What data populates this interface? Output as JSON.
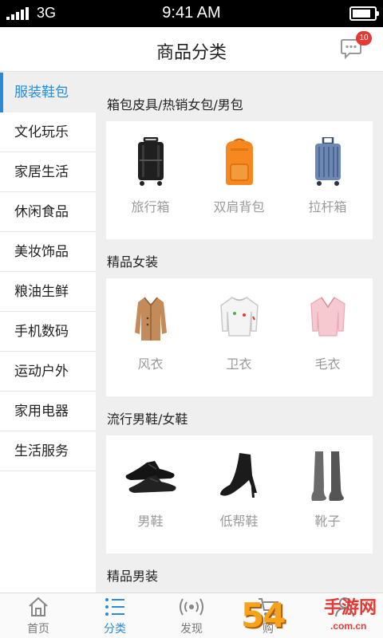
{
  "status_bar": {
    "carrier": "3G",
    "time": "9:41 AM",
    "signal_bars": 5,
    "battery_level": 0.85
  },
  "header": {
    "title": "商品分类",
    "message_badge": "10",
    "message_icon": "chat-bubble-icon"
  },
  "sidebar": {
    "active_color": "#2a8ad5",
    "items": [
      {
        "label": "服装鞋包",
        "active": true
      },
      {
        "label": "文化玩乐"
      },
      {
        "label": "家居生活"
      },
      {
        "label": "休闲食品"
      },
      {
        "label": "美妆饰品"
      },
      {
        "label": "粮油生鲜"
      },
      {
        "label": "手机数码"
      },
      {
        "label": "运动户外"
      },
      {
        "label": "家用电器"
      },
      {
        "label": "生活服务"
      }
    ]
  },
  "sections": [
    {
      "title": "箱包皮具/热销女包/男包",
      "products": [
        {
          "label": "旅行箱",
          "icon": "black-suitcase-icon"
        },
        {
          "label": "双肩背包",
          "icon": "orange-backpack-icon"
        },
        {
          "label": "拉杆箱",
          "icon": "blue-trolley-case-icon"
        }
      ]
    },
    {
      "title": "精品女装",
      "products": [
        {
          "label": "风衣",
          "icon": "trench-coat-icon"
        },
        {
          "label": "卫衣",
          "icon": "white-sweatshirt-icon"
        },
        {
          "label": "毛衣",
          "icon": "pink-sweater-icon"
        }
      ]
    },
    {
      "title": "流行男鞋/女鞋",
      "products": [
        {
          "label": "男鞋",
          "icon": "leather-shoes-icon"
        },
        {
          "label": "低帮鞋",
          "icon": "heeled-bootie-icon"
        },
        {
          "label": "靴子",
          "icon": "knee-high-boot-icon"
        }
      ]
    },
    {
      "title": "精品男装",
      "products": []
    }
  ],
  "tabbar": {
    "items": [
      {
        "label": "首页",
        "icon": "home-icon"
      },
      {
        "label": "分类",
        "icon": "category-list-icon",
        "active": true
      },
      {
        "label": "发现",
        "icon": "broadcast-icon"
      },
      {
        "label": "购",
        "icon": "cart-icon"
      },
      {
        "label": "",
        "icon": "profile-icon"
      }
    ]
  },
  "watermark": {
    "number": "54",
    "text": "手游网",
    "site": ".com.cn"
  }
}
